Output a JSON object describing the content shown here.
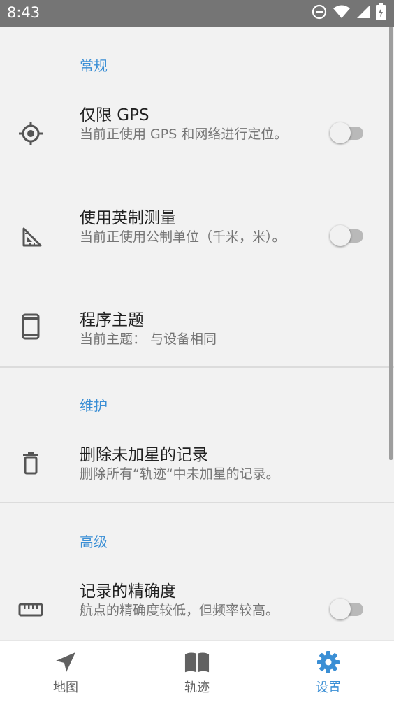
{
  "status_bar": {
    "time": "8:43"
  },
  "sections": {
    "general": {
      "header": "常规",
      "gps": {
        "title": "仅限 GPS",
        "summary": "当前正使用 GPS 和网络进行定位。",
        "icon": "gps-fixed-icon",
        "enabled": false
      },
      "imperial": {
        "title": "使用英制测量",
        "summary": "当前正使用公制单位（千米，米）。",
        "icon": "set-square-icon",
        "enabled": false
      },
      "theme": {
        "title": "程序主题",
        "summary": "当前主题： 与设备相同",
        "icon": "phone-icon"
      }
    },
    "maintenance": {
      "header": "维护",
      "delete": {
        "title": "删除未加星的记录",
        "summary": "删除所有“轨迹“中未加星的记录。",
        "icon": "trash-icon"
      }
    },
    "advanced": {
      "header": "高级",
      "accuracy": {
        "title": "记录的精确度",
        "summary": "航点的精确度较低，但频率较高。",
        "icon": "ruler-icon",
        "enabled": false
      }
    }
  },
  "bottom_nav": {
    "items": [
      {
        "label": "地图",
        "icon": "navigation-arrow-icon",
        "active": false
      },
      {
        "label": "轨迹",
        "icon": "book-icon",
        "active": false
      },
      {
        "label": "设置",
        "icon": "gear-icon",
        "active": true
      }
    ]
  },
  "colors": {
    "accent": "#3b8fd5",
    "status_bar": "#757575",
    "background": "#f2f2f2"
  }
}
